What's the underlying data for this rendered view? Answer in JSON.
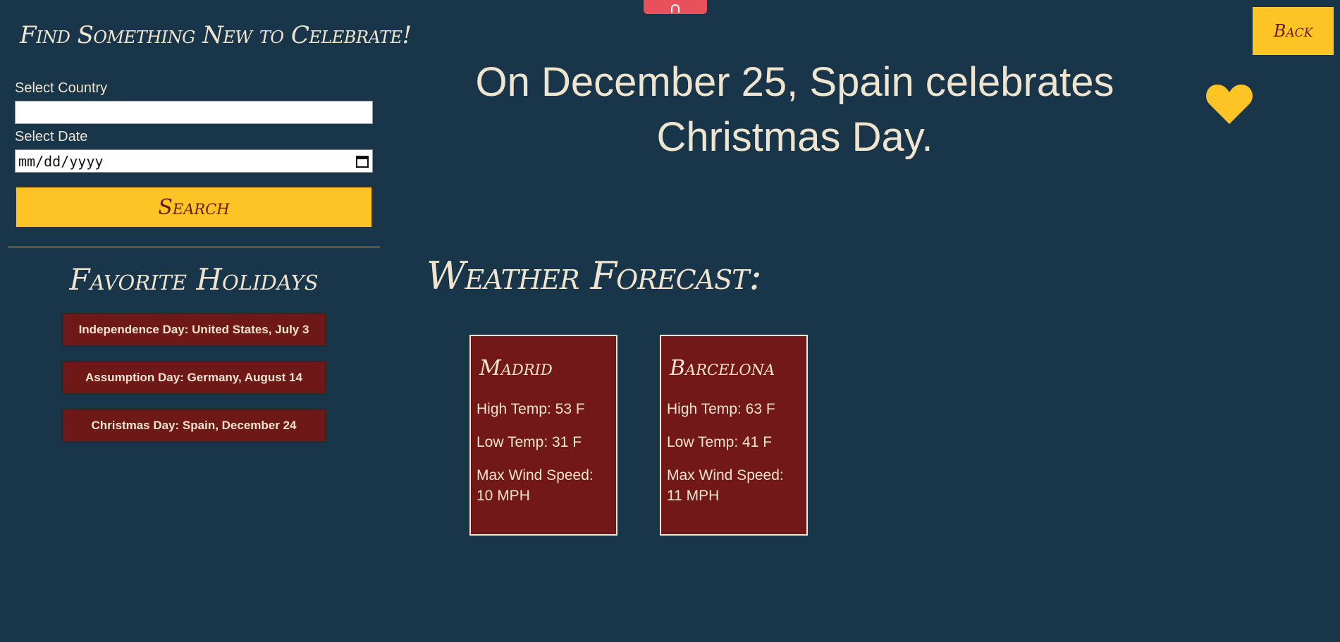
{
  "sidebar": {
    "title": "Find Something New to Celebrate!",
    "country_label": "Select Country",
    "country_value": "",
    "date_label": "Select Date",
    "date_placeholder": "mm/dd/yyyy",
    "search_label": "Search",
    "favorites_title": "Favorite Holidays",
    "favorites": [
      "Independence Day: United States, July 3",
      "Assumption Day: Germany, August 14",
      "Christmas Day: Spain, December 24"
    ]
  },
  "main": {
    "headline": "On December 25, Spain celebrates Christmas Day.",
    "back_label": "Back",
    "forecast_title": "Weather Forecast:",
    "forecasts": [
      {
        "city": "Madrid",
        "high": "High Temp: 53 F",
        "low": "Low Temp: 31 F",
        "wind": "Max Wind Speed: 10 MPH"
      },
      {
        "city": "Barcelona",
        "high": "High Temp: 63 F",
        "low": "Low Temp: 41 F",
        "wind": "Max Wind Speed: 11 MPH"
      }
    ]
  },
  "colors": {
    "background": "#193549",
    "accent": "#fec325",
    "card": "#731818",
    "text": "#efe5cf"
  },
  "icons": [
    "heart-icon",
    "calendar-icon",
    "collapse-tab-icon"
  ]
}
